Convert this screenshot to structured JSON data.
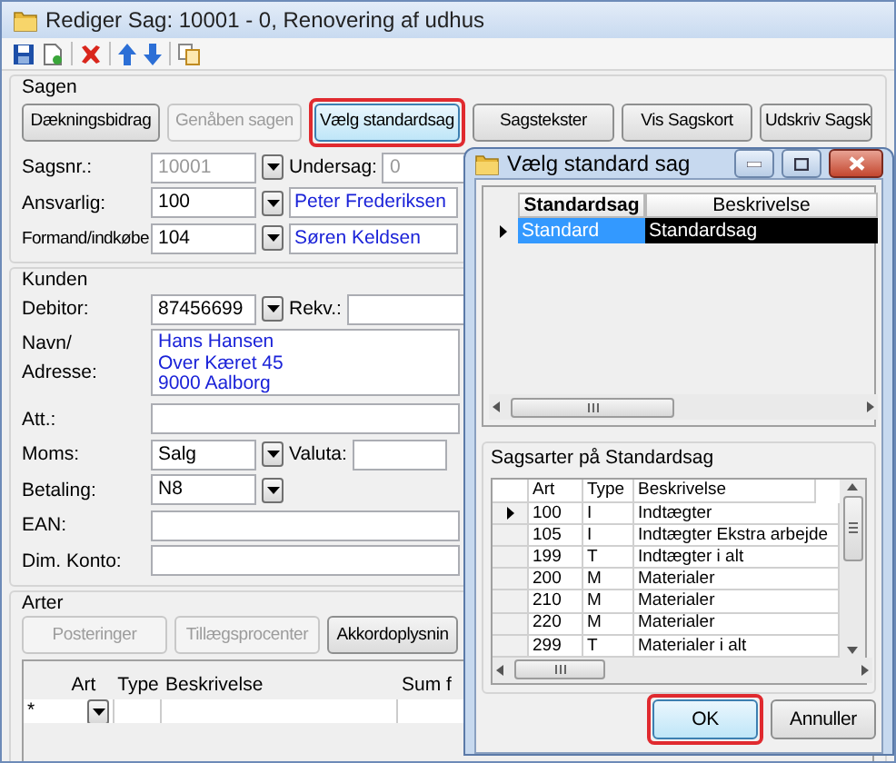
{
  "window": {
    "title": "Rediger Sag: 10001 - 0, Renovering af udhus"
  },
  "sagen": {
    "title": "Sagen",
    "buttons": [
      {
        "label": "Dækningsbidrag",
        "disabled": false,
        "highlighted": false
      },
      {
        "label": "Genåben sagen",
        "disabled": true,
        "highlighted": false
      },
      {
        "label": "Vælg standardsag",
        "disabled": false,
        "highlighted": true
      },
      {
        "label": "Sagstekster",
        "disabled": false,
        "highlighted": false
      },
      {
        "label": "Vis Sagskort",
        "disabled": false,
        "highlighted": false
      },
      {
        "label": "Udskriv Sagsk",
        "disabled": false,
        "highlighted": false
      }
    ],
    "sagsnr": {
      "label": "Sagsnr.:",
      "value": "10001",
      "disabled": true
    },
    "undersag": {
      "label": "Undersag:",
      "value": "0",
      "disabled": true
    },
    "ansvarlig": {
      "label": "Ansvarlig:",
      "value": "100",
      "name": "Peter Frederiksen"
    },
    "formand": {
      "label": "Formand/indkøbe",
      "value": "104",
      "name": "Søren Keldsen"
    }
  },
  "kunden": {
    "title": "Kunden",
    "debitor": {
      "label": "Debitor:",
      "value": "87456699"
    },
    "rekv": {
      "label": "Rekv.:"
    },
    "adresse": {
      "label_lines": [
        "Navn/",
        "Adresse:"
      ],
      "lines": [
        "Hans Hansen",
        "Over Kæret 45",
        "9000 Aalborg"
      ]
    },
    "att": {
      "label": "Att.:"
    },
    "moms": {
      "label": "Moms:",
      "value": "Salg"
    },
    "valuta": {
      "label": "Valuta:"
    },
    "betaling": {
      "label": "Betaling:",
      "value": "N8"
    },
    "ean": {
      "label": "EAN:"
    },
    "dim_konto": {
      "label": "Dim. Konto:"
    }
  },
  "arter": {
    "title": "Arter",
    "buttons": [
      {
        "label": "Posteringer",
        "disabled": true
      },
      {
        "label": "Tillægsprocenter",
        "disabled": true
      },
      {
        "label": "Akkordoplysnin",
        "disabled": false
      }
    ],
    "columns": [
      "Art",
      "Type",
      "Beskrivelse",
      "Sum f"
    ],
    "new_row_marker": "*"
  },
  "dialog": {
    "title": "Vælg standard sag",
    "columns": [
      {
        "label": "Standardsag",
        "selected": true
      },
      {
        "label": "Beskrivelse",
        "selected": false
      }
    ],
    "rows": [
      {
        "standardsag": "Standard",
        "beskrivelse": "Standardsag",
        "selected": true
      }
    ],
    "group_title": "Sagsarter på Standardsag",
    "art_columns": [
      "Art",
      "Type",
      "Beskrivelse"
    ],
    "art_rows": [
      {
        "art": "100",
        "type": "I",
        "beskrivelse": "Indtægter",
        "selected": true
      },
      {
        "art": "105",
        "type": "I",
        "beskrivelse": "Indtægter Ekstra arbejde",
        "selected": false
      },
      {
        "art": "199",
        "type": "T",
        "beskrivelse": "Indtægter i alt",
        "selected": false
      },
      {
        "art": "200",
        "type": "M",
        "beskrivelse": "Materialer",
        "selected": false
      },
      {
        "art": "210",
        "type": "M",
        "beskrivelse": "Materialer",
        "selected": false
      },
      {
        "art": "220",
        "type": "M",
        "beskrivelse": "Materialer",
        "selected": false
      },
      {
        "art": "299",
        "type": "T",
        "beskrivelse": "Materialer i alt",
        "selected": false
      }
    ],
    "buttons": [
      {
        "label": "OK",
        "highlighted": true
      },
      {
        "label": "Annuller",
        "highlighted": false
      }
    ]
  }
}
